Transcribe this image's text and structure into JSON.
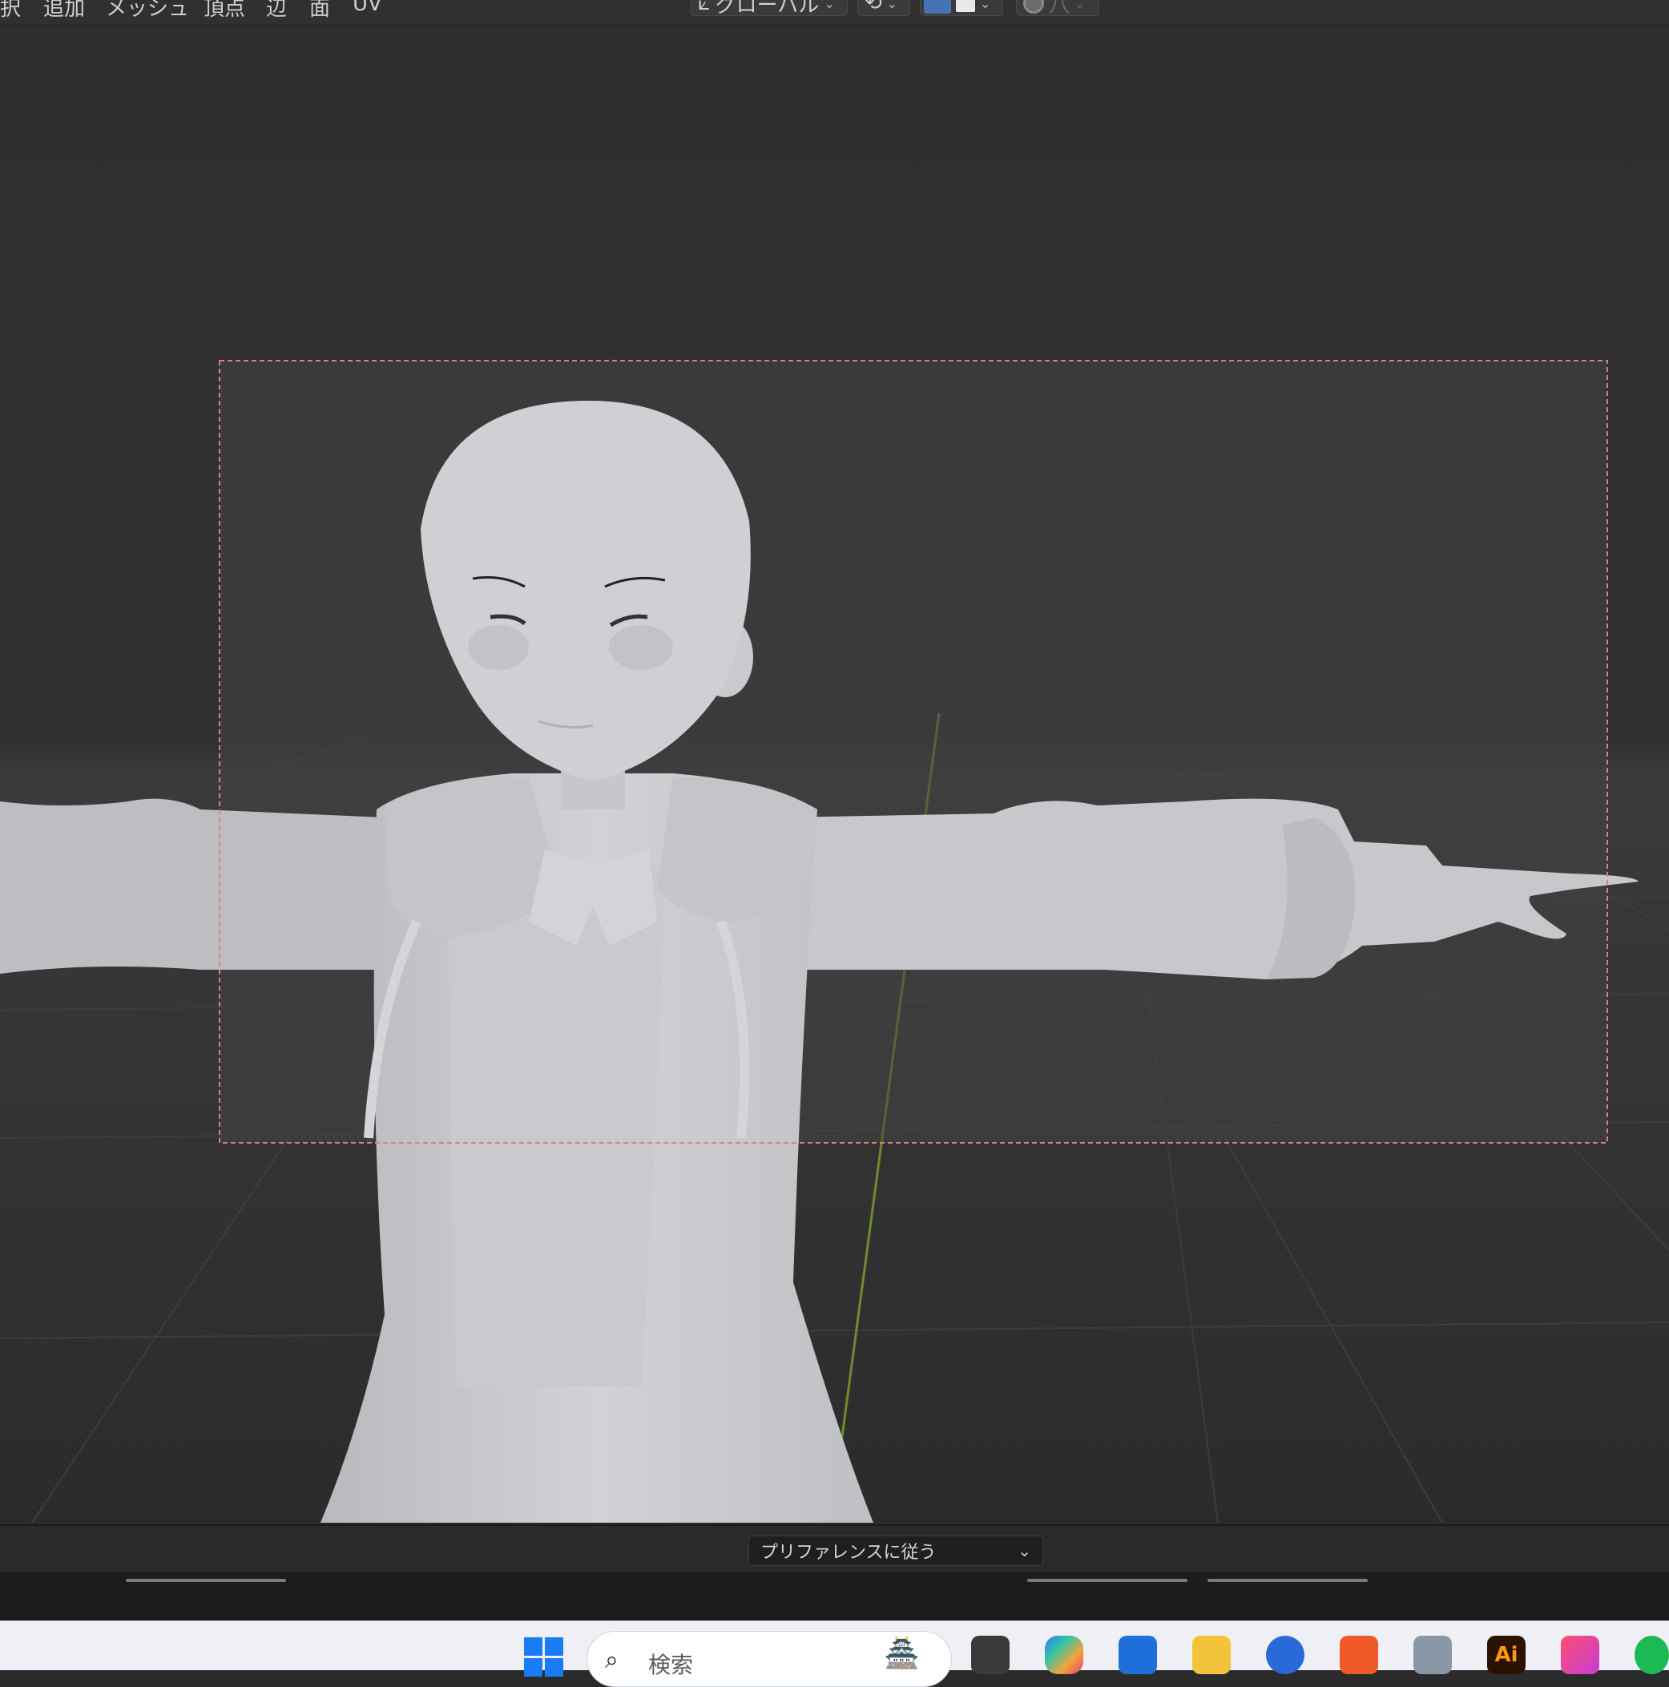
{
  "menu": {
    "items": [
      "択",
      "追加",
      "メッシュ",
      "頂点",
      "辺",
      "面",
      "UV"
    ]
  },
  "header_tools": {
    "transform_orientation": "グローバル",
    "proportional_label": "八"
  },
  "viewport": {
    "background": "#2d2d2d",
    "camera_frame_color": "#d98080",
    "model_color": "#cbcccf",
    "y_axis_color": "#6e8c2e"
  },
  "bottom": {
    "preference_select": "プリファレンスに従う"
  },
  "taskbar": {
    "search_placeholder": "検索",
    "apps": [
      {
        "name": "task-view",
        "label": ""
      },
      {
        "name": "copilot",
        "label": ""
      },
      {
        "name": "microsoft-store",
        "label": ""
      },
      {
        "name": "file-explorer",
        "label": ""
      },
      {
        "name": "thunderbird",
        "label": ""
      },
      {
        "name": "brave",
        "label": ""
      },
      {
        "name": "calculator",
        "label": ""
      },
      {
        "name": "illustrator",
        "label": "Ai"
      },
      {
        "name": "creative-cloud",
        "label": ""
      },
      {
        "name": "spotify",
        "label": ""
      }
    ]
  }
}
